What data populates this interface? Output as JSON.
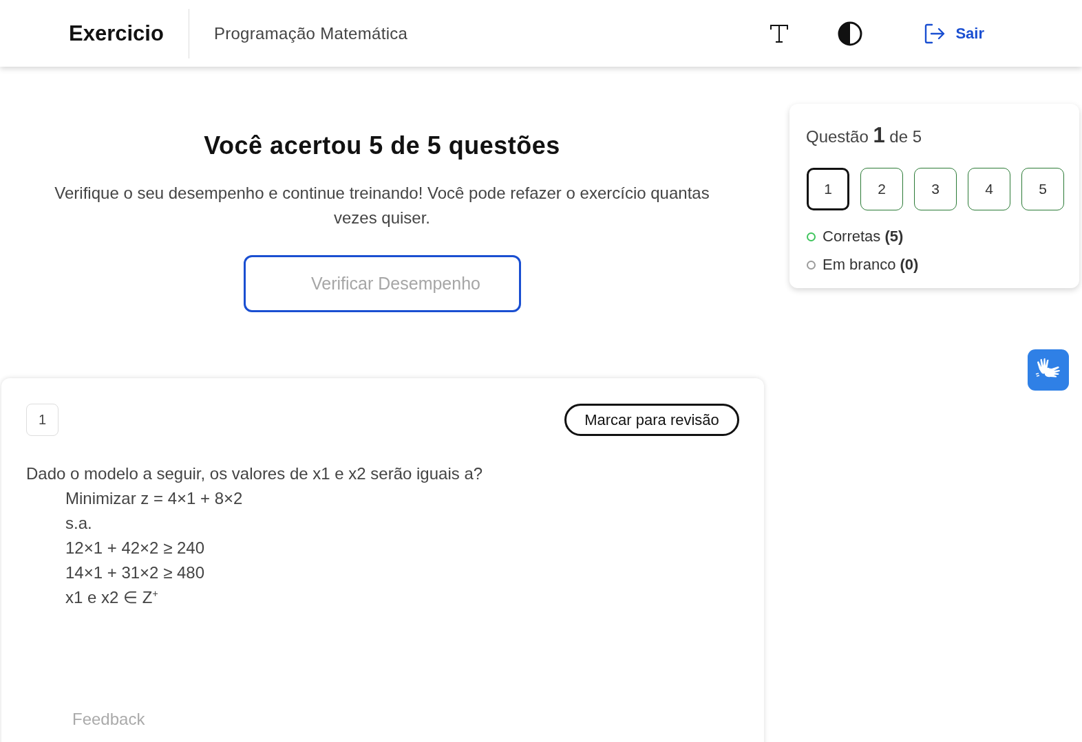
{
  "header": {
    "brand": "Exercicio",
    "subject": "Programação Matemática",
    "logout": "Sair"
  },
  "result": {
    "title": "Você acertou 5 de 5 questões",
    "message": "Verifique o seu desempenho e continue treinando! Você pode refazer o exercício quantas vezes quiser.",
    "button": "Verificar Desempenho"
  },
  "question": {
    "number": "1",
    "review_button": "Marcar para revisão",
    "prompt": "Dado o modelo a seguir, os valores de x1 e x2 serão iguais a?",
    "model_lines": [
      "Minimizar z = 4×1 + 8×2",
      "s.a.",
      "12×1 + 42×2 ≥ 240",
      "14×1 + 31×2 ≥ 480",
      "x1 e x2 ∈ Z$^{+}$"
    ],
    "feedback": "Feedback"
  },
  "navigator": {
    "title": "Questão **1** de 5",
    "questions": [
      {
        "label": "1",
        "selected": true,
        "correct": true
      },
      {
        "label": "2",
        "selected": false,
        "correct": true
      },
      {
        "label": "3",
        "selected": false,
        "correct": true
      },
      {
        "label": "4",
        "selected": false,
        "correct": true
      },
      {
        "label": "5",
        "selected": false,
        "correct": true
      }
    ],
    "legend": [
      {
        "label": "Corretas **(5)**",
        "color": "#3ec45c"
      },
      {
        "label": "Em branco **(0)**",
        "color": "#9b9b9b"
      }
    ]
  }
}
